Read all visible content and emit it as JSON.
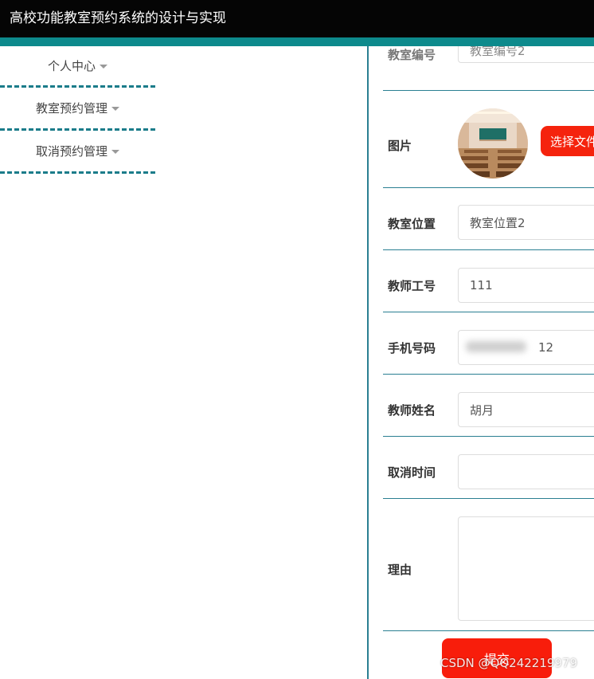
{
  "header": {
    "title": "高校功能教室预约系统的设计与实现"
  },
  "sidebar": {
    "items": [
      {
        "label": "个人中心"
      },
      {
        "label": "教室预约管理"
      },
      {
        "label": "取消预约管理"
      }
    ]
  },
  "form": {
    "room_no": {
      "label": "教室编号",
      "value": "教室编号2"
    },
    "image": {
      "label": "图片",
      "file_button": "选择文件"
    },
    "location": {
      "label": "教室位置",
      "value": "教室位置2"
    },
    "teacher_id": {
      "label": "教师工号",
      "value": "111"
    },
    "phone": {
      "label": "手机号码",
      "value": "12"
    },
    "teacher_name": {
      "label": "教师姓名",
      "value": "胡月"
    },
    "cancel_time": {
      "label": "取消时间",
      "value": ""
    },
    "reason": {
      "label": "理由",
      "value": ""
    },
    "submit_label": "提交"
  },
  "watermark": "CSDN @QQ242219979",
  "colors": {
    "accent_teal": "#0d8a8c",
    "divider": "#2a7f92",
    "button_red": "#f5230d",
    "topbar": "#050505"
  }
}
